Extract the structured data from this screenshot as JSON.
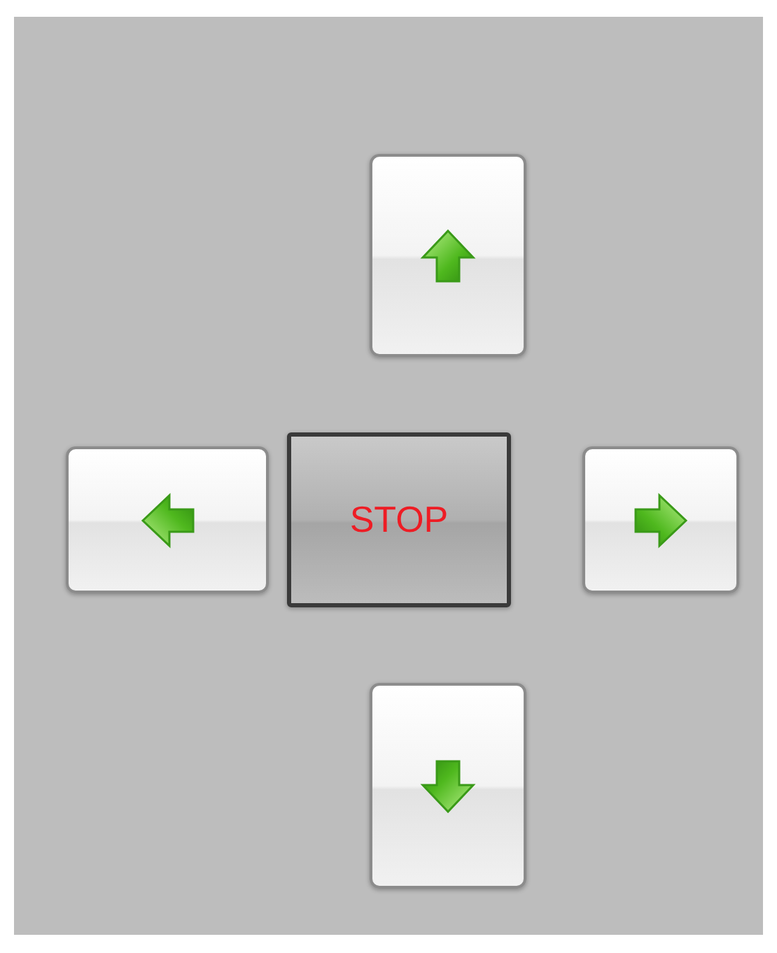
{
  "buttons": [
    {
      "kind": "up"
    },
    {
      "kind": "left"
    },
    {
      "kind": "stop",
      "label": "STOP"
    },
    {
      "kind": "right"
    },
    {
      "kind": "down"
    }
  ]
}
